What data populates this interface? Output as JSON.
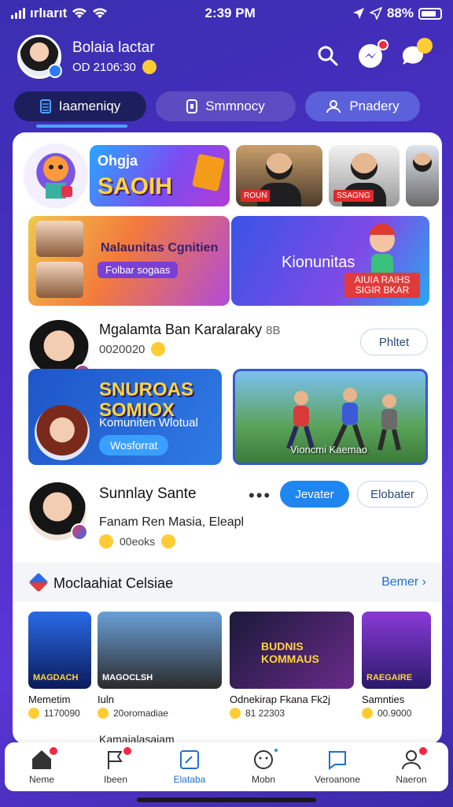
{
  "status": {
    "carrier": "ırlıarıt",
    "time": "2:39 PM",
    "battery": "88%"
  },
  "profile": {
    "name": "Bolaia lactar",
    "sub": "OD 2106:30"
  },
  "tabs": [
    {
      "label": "Iaameniqy"
    },
    {
      "label": "Smmnocy"
    },
    {
      "label": "Pnadery"
    }
  ],
  "banners": {
    "saoh_title": "Ohgja",
    "saoh_big": "SAOIH",
    "thumb1_tag": "ROUN",
    "thumb2_tag": "SSAGNG",
    "game_text": "Nalaunitas Cgnitien",
    "game_button": "Folbar sogaas",
    "komu_text": "Kionunitas",
    "komu_button": "AIUIA RAIHS SIGIR BKAR"
  },
  "post1": {
    "name": "Mgalamta Ban Karalaraky",
    "name_suffix": "8B",
    "sub": "0020020",
    "follow": "Phltet"
  },
  "promo": {
    "title": "SNUROAS SOMIOX",
    "sub": "Komuniten Wlotual",
    "button": "Wosforrat",
    "dance_text": "Vioncmi Kaemao"
  },
  "post2": {
    "name": "Sunnlay Sante",
    "text": "Fanam Ren Masia, Eleapl",
    "meta": "00eoks",
    "more": "•••",
    "join": "Jevater",
    "other": "Elobater"
  },
  "section": {
    "title": "Moclaahiat Celsiae",
    "link": "Bemer ›"
  },
  "recs": [
    {
      "label": "MAGDACH",
      "caption": "Memetim",
      "meta": "1170090"
    },
    {
      "label": "MAGOCLSH",
      "caption": "Iuln",
      "meta": "20oromadiae"
    },
    {
      "label": "BUDNIS KOMMAUS",
      "caption": "Odnekirap Fkana Fk2j",
      "meta": "81 22303"
    },
    {
      "label": "RAEGAIRE",
      "caption": "Samnties",
      "meta": "00.9000"
    }
  ],
  "peek": "Kamaialasaiam",
  "nav": [
    {
      "label": "Neme",
      "badge": true
    },
    {
      "label": "Ibeen",
      "badge": true
    },
    {
      "label": "Elataba",
      "badge": false
    },
    {
      "label": "Mobn",
      "badge": true
    },
    {
      "label": "Veroanone",
      "badge": false
    },
    {
      "label": "Naeron",
      "badge": true
    }
  ],
  "colors": {
    "accent": "#1f86f0",
    "badge": "#f02848",
    "bg": "#4b2ec4"
  }
}
